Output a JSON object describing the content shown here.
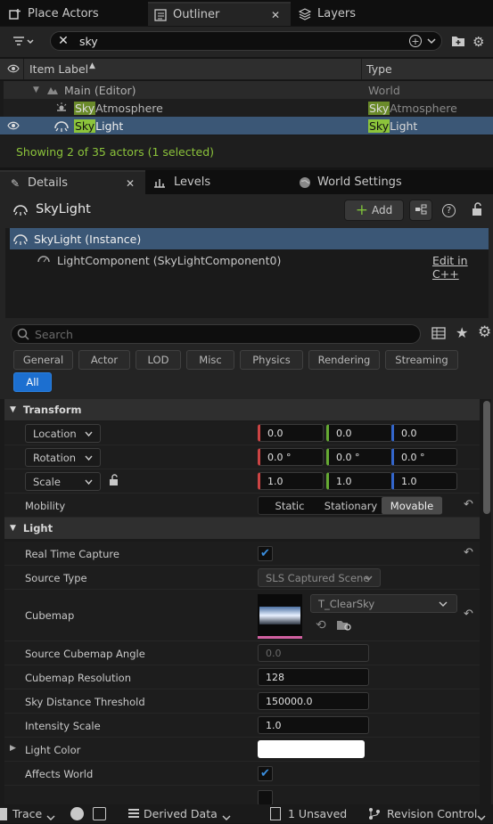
{
  "top_tabs": [
    {
      "label": "Place Actors",
      "icon": "cube-plus-icon"
    },
    {
      "label": "Outliner",
      "icon": "outliner-icon"
    },
    {
      "label": "Layers",
      "icon": "layers-icon"
    }
  ],
  "outliner": {
    "search_value": "sky",
    "columns": {
      "label": "Item Label",
      "type": "Type"
    },
    "rows": [
      {
        "name": "Main (Editor)",
        "type": "World"
      },
      {
        "name_hl": "Sky",
        "name_rest": "Atmosphere",
        "type_hl": "Sky",
        "type_rest": "Atmosphere"
      },
      {
        "name_hl": "Sky",
        "name_rest": "Light",
        "type_hl": "Sky",
        "type_rest": "Light"
      }
    ],
    "status": "Showing 2 of 35 actors (1 selected)"
  },
  "details_tabs": [
    {
      "label": "Details",
      "icon": "pencil-icon"
    },
    {
      "label": "Levels",
      "icon": "levels-icon"
    },
    {
      "label": "World Settings",
      "icon": "globe-icon"
    }
  ],
  "details": {
    "actor_name": "SkyLight",
    "add_label": "Add",
    "instance_label": "SkyLight (Instance)",
    "component_label": "LightComponent (SkyLightComponent0)",
    "edit_cpp": "Edit in C++",
    "search_placeholder": "Search",
    "categories": [
      "General",
      "Actor",
      "LOD",
      "Misc",
      "Physics",
      "Rendering",
      "Streaming",
      "All"
    ]
  },
  "transform": {
    "title": "Transform",
    "location": {
      "label": "Location",
      "x": "0.0",
      "y": "0.0",
      "z": "0.0"
    },
    "rotation": {
      "label": "Rotation",
      "x": "0.0 °",
      "y": "0.0 °",
      "z": "0.0 °"
    },
    "scale": {
      "label": "Scale",
      "x": "1.0",
      "y": "1.0",
      "z": "1.0"
    },
    "mobility_label": "Mobility",
    "mobility_options": [
      "Static",
      "Stationary",
      "Movable"
    ]
  },
  "light": {
    "title": "Light",
    "real_time_capture": "Real Time Capture",
    "source_type_label": "Source Type",
    "source_type_value": "SLS Captured Scene",
    "cubemap_label": "Cubemap",
    "cubemap_value": "T_ClearSky",
    "source_angle_label": "Source Cubemap Angle",
    "source_angle_value": "0.0",
    "cubemap_res_label": "Cubemap Resolution",
    "cubemap_res_value": "128",
    "sky_dist_label": "Sky Distance Threshold",
    "sky_dist_value": "150000.0",
    "intensity_label": "Intensity Scale",
    "intensity_value": "1.0",
    "light_color_label": "Light Color",
    "affects_world_label": "Affects World"
  },
  "bottom": {
    "trace": "Trace",
    "derived_data": "Derived Data",
    "unsaved": "1 Unsaved",
    "revision_control": "Revision Control"
  },
  "colors": {
    "accent_green": "#8cc43b",
    "selection": "#3a5a7a",
    "checkbox_blue": "#3a8fe0"
  }
}
